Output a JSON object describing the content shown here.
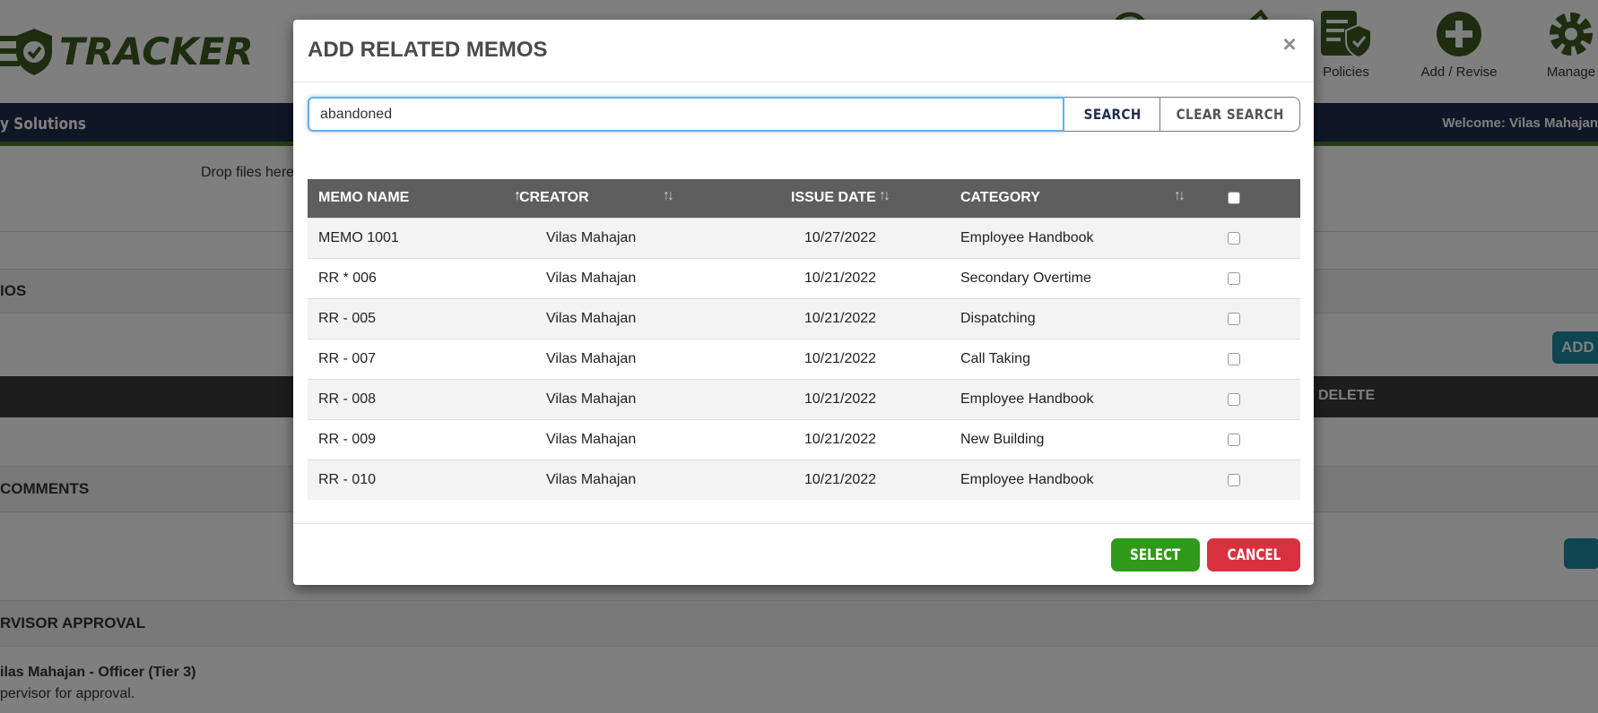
{
  "background": {
    "logo_text": "TRACKER",
    "top_icons": [
      {
        "label": "Policies",
        "icon": "policy-shield-icon"
      },
      {
        "label": "Add / Revise",
        "icon": "plus-circle-icon"
      },
      {
        "label": "Manage",
        "icon": "gear-icon"
      }
    ],
    "nav_brand": "y Solutions",
    "welcome": "Welcome: Vilas Mahajan",
    "drop_text": "Drop files here",
    "section_memos": "IOS",
    "add_button": "ADD",
    "delete_header": "DELETE",
    "section_comments": "COMMENTS",
    "section_approval": "RVISOR APPROVAL",
    "approver_line": "ilas Mahajan - Officer (Tier 3)",
    "approval_note": "pervisor for approval."
  },
  "modal": {
    "title": "ADD RELATED MEMOS",
    "close_label": "×",
    "search": {
      "value": "abandoned",
      "search_label": "SEARCH",
      "clear_label": "CLEAR SEARCH"
    },
    "columns": [
      "MEMO NAME",
      "CREATOR",
      "ISSUE DATE",
      "CATEGORY"
    ],
    "rows": [
      {
        "name": "MEMO 1001",
        "creator": "Vilas Mahajan",
        "date": "10/27/2022",
        "category": "Employee Handbook"
      },
      {
        "name": "RR * 006",
        "creator": "Vilas Mahajan",
        "date": "10/21/2022",
        "category": "Secondary Overtime"
      },
      {
        "name": "RR - 005",
        "creator": "Vilas Mahajan",
        "date": "10/21/2022",
        "category": "Dispatching"
      },
      {
        "name": "RR - 007",
        "creator": "Vilas Mahajan",
        "date": "10/21/2022",
        "category": "Call Taking"
      },
      {
        "name": "RR - 008",
        "creator": "Vilas Mahajan",
        "date": "10/21/2022",
        "category": "Employee Handbook"
      },
      {
        "name": "RR - 009",
        "creator": "Vilas Mahajan",
        "date": "10/21/2022",
        "category": "New Building"
      },
      {
        "name": "RR - 010",
        "creator": "Vilas Mahajan",
        "date": "10/21/2022",
        "category": "Employee Handbook"
      }
    ],
    "select_label": "SELECT",
    "cancel_label": "CANCEL"
  },
  "colors": {
    "brand_green": "#3c5a1e",
    "navbar": "#1f2f4f",
    "select_green": "#2e9a1a",
    "cancel_red": "#d9303f",
    "grid_header": "#5e5e5e"
  }
}
